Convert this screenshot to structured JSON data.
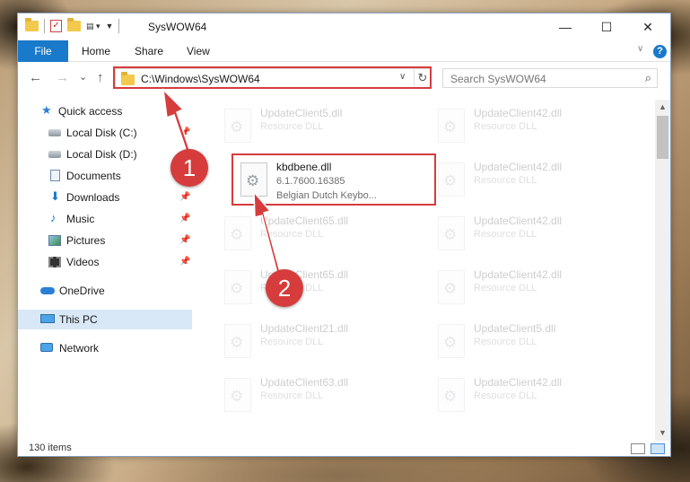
{
  "window": {
    "title": "SysWOW64",
    "minimize": "—",
    "maximize": "☐",
    "close": "✕"
  },
  "ribbon": {
    "tabs": [
      "File",
      "Home",
      "Share",
      "View"
    ],
    "help": "?"
  },
  "nav": {
    "back": "←",
    "forward": "→",
    "recent": "⌄",
    "up": "↑",
    "address": "C:\\Windows\\SysWOW64",
    "search_placeholder": "Search SysWOW64"
  },
  "sidebar": {
    "items": [
      {
        "label": "Quick access",
        "icon": "star-icon",
        "pinned": false
      },
      {
        "label": "Local Disk (C:)",
        "icon": "drive-icon",
        "pinned": true
      },
      {
        "label": "Local Disk (D:)",
        "icon": "drive-icon",
        "pinned": false
      },
      {
        "label": "Documents",
        "icon": "documents-icon",
        "pinned": true
      },
      {
        "label": "Downloads",
        "icon": "download-icon",
        "pinned": true
      },
      {
        "label": "Music",
        "icon": "music-icon",
        "pinned": true
      },
      {
        "label": "Pictures",
        "icon": "pictures-icon",
        "pinned": true
      },
      {
        "label": "Videos",
        "icon": "videos-icon",
        "pinned": true
      },
      {
        "label": "OneDrive",
        "icon": "onedrive-icon",
        "pinned": false
      },
      {
        "label": "This PC",
        "icon": "this-pc-icon",
        "pinned": false,
        "selected": true
      },
      {
        "label": "Network",
        "icon": "network-icon",
        "pinned": false
      }
    ]
  },
  "files": [
    {
      "name": "UpdateClient5.dll",
      "type": "Resource DLL",
      "faded": true
    },
    {
      "name": "UpdateClient42.dll",
      "type": "Resource DLL",
      "faded": true
    },
    {
      "name": "kbdbene.dll",
      "version": "6.1.7600.16385",
      "description": "Belgian Dutch Keybo...",
      "faded": false,
      "highlighted": true
    },
    {
      "name": "UpdateClient42.dll",
      "type": "Resource DLL",
      "faded": true
    },
    {
      "name": "UpdateClient65.dll",
      "type": "Resource DLL",
      "faded": true
    },
    {
      "name": "UpdateClient42.dll",
      "type": "Resource DLL",
      "faded": true
    },
    {
      "name": "UpdateClient65.dll",
      "type": "Resource DLL",
      "faded": true
    },
    {
      "name": "UpdateClient42.dll",
      "type": "Resource DLL",
      "faded": true
    },
    {
      "name": "UpdateClient21.dll",
      "type": "Resource DLL",
      "faded": true
    },
    {
      "name": "UpdateClient5.dll",
      "type": "Resource DLL",
      "faded": true
    },
    {
      "name": "UpdateClient63.dll",
      "type": "Resource DLL",
      "faded": true
    },
    {
      "name": "UpdateClient42.dll",
      "type": "Resource DLL",
      "faded": true
    }
  ],
  "status": {
    "item_count": "130 items"
  },
  "callouts": {
    "step1": "1",
    "step2": "2",
    "color": "#d63c3c"
  }
}
